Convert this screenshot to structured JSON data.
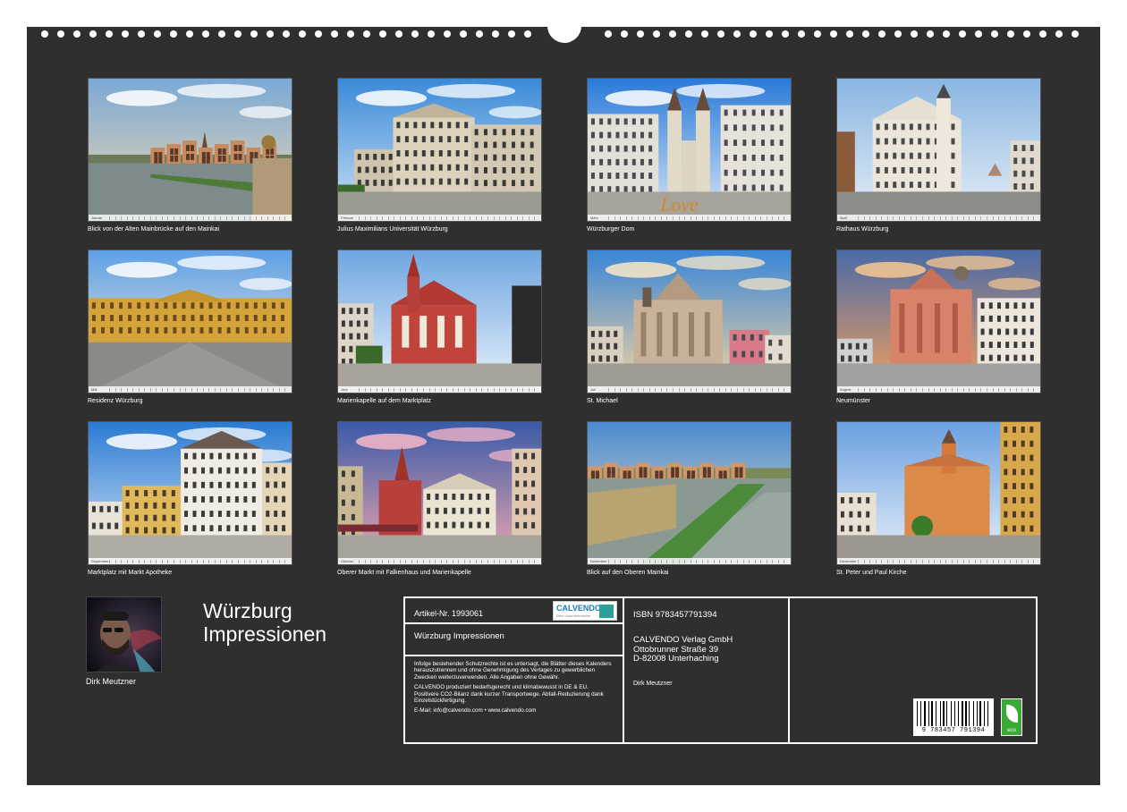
{
  "calendar": {
    "title_line1": "Würzburg",
    "title_line2": "Impressionen",
    "author": "Dirk Meutzner"
  },
  "months": [
    {
      "month": "Januar",
      "caption": "Blick von der Alten Mainbrücke auf den Mainkai",
      "scene": "river"
    },
    {
      "month": "Februar",
      "caption": "Julius Maximilians Universität Würzburg",
      "scene": "palace"
    },
    {
      "month": "März",
      "caption": "Würzburger Dom",
      "scene": "cathedral"
    },
    {
      "month": "April",
      "caption": "Rathaus Würzburg",
      "scene": "townhall"
    },
    {
      "month": "Mai",
      "caption": "Residenz Würzburg",
      "scene": "residenz"
    },
    {
      "month": "Juni",
      "caption": "Marienkapelle auf dem Marktplatz",
      "scene": "gothic"
    },
    {
      "month": "Juli",
      "caption": "St. Michael",
      "scene": "baroque"
    },
    {
      "month": "August",
      "caption": "Neumünster",
      "scene": "neumuenster"
    },
    {
      "month": "September",
      "caption": "Marktplatz mit Markt Apotheke",
      "scene": "market"
    },
    {
      "month": "Oktober",
      "caption": "Oberer Markt mit Falkenhaus und Marienkapelle",
      "scene": "upper"
    },
    {
      "month": "November",
      "caption": "Blick auf den Oberen Mainkai",
      "scene": "mainkai"
    },
    {
      "month": "Dezember",
      "caption": "St. Peter und Paul Kirche",
      "scene": "peterpaul"
    }
  ],
  "info": {
    "article": "Artikel-Nr. 1993061",
    "logo_text": "CALVENDO",
    "logo_sub": "Dein Kalendermacher",
    "product_name": "Würzburg Impressionen",
    "legal1": "Infolge bestehender Schutzrechte ist es untersagt, die Blätter dieses Kalenders herauszutrennen und ohne Genehmigung des Verlages zu gewerblichen Zwecken weiterzuverwenden. Alle Angaben ohne Gewähr.",
    "legal2": "CALVENDO produziert bedarfsgerecht und klimabewusst in DE & EU. Positivere CO2-Bilanz dank kurzer Transportwege. Abfall-Reduzierung dank Einzelstückfertigung.",
    "contact": "E-Mail: info@calvendo.com • www.calvendo.com",
    "isbn": "ISBN 9783457791394",
    "publisher_name": "CALVENDO Verlag GmbH",
    "publisher_street": "Ottobrunner Straße 39",
    "publisher_city": "D-82008 Unterhaching",
    "photographer": "Dirk Meutzner",
    "barcode_number": "9 783457 791394",
    "eco_label": "eco"
  }
}
